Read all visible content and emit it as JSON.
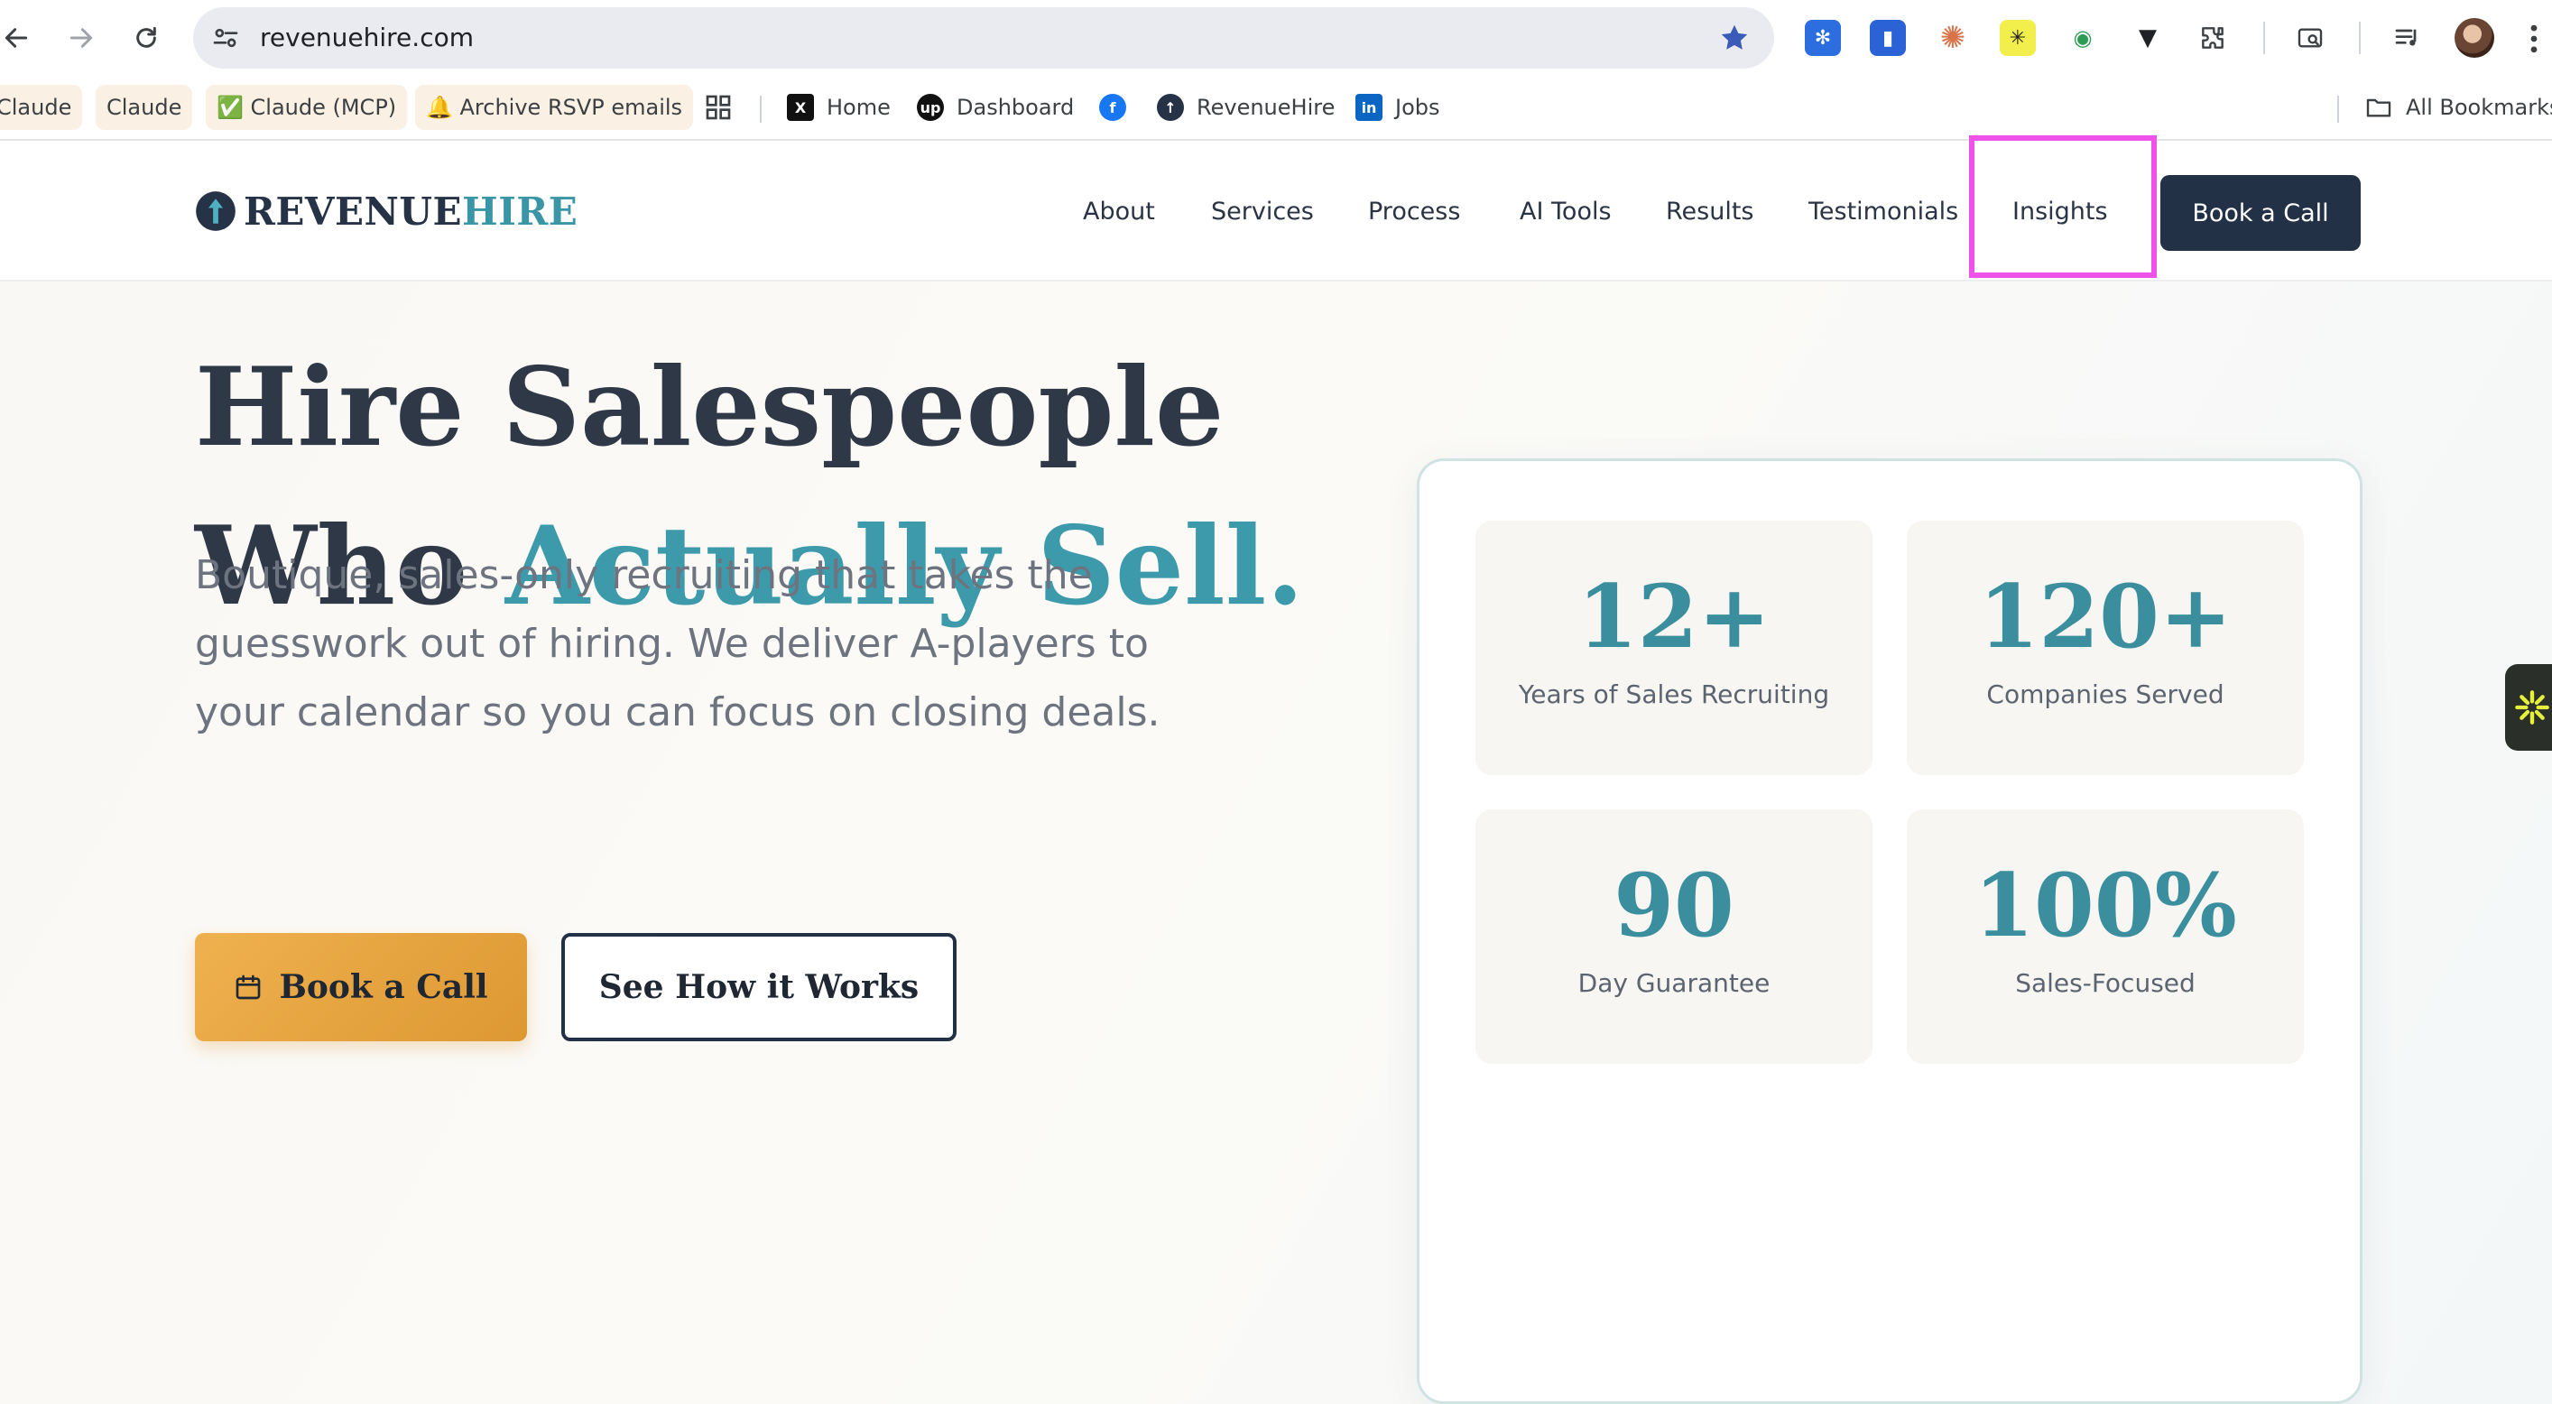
{
  "browser": {
    "url": "revenuehire.com",
    "bookmarks": [
      {
        "label": "Claude"
      },
      {
        "label": "Claude"
      },
      {
        "label": "✅ Claude (MCP)"
      },
      {
        "label": "🔔 Archive RSVP emails"
      },
      {
        "label": "Home"
      },
      {
        "label": "Dashboard"
      },
      {
        "label": "RevenueHire"
      },
      {
        "label": "Jobs"
      }
    ],
    "all_bookmarks": "All Bookmarks"
  },
  "site": {
    "logo_part1": "REVENUE",
    "logo_part2": "HIRE",
    "nav": [
      "About",
      "Services",
      "Process",
      "AI Tools",
      "Results",
      "Testimonials",
      "Insights"
    ],
    "header_cta": "Book a Call"
  },
  "hero": {
    "title_line1": "Hire Salespeople",
    "title_line2_plain": "Who ",
    "title_line2_accent": "Actually Sell.",
    "subtitle": "Boutique, sales-only recruiting that takes the guesswork out of hiring. We deliver A-players to your calendar so you can focus on closing deals.",
    "primary_cta": "Book a Call",
    "secondary_cta": "See How it Works"
  },
  "stats": [
    {
      "value": "12+",
      "label": "Years of Sales Recruiting"
    },
    {
      "value": "120+",
      "label": "Companies Served"
    },
    {
      "value": "90",
      "label": "Day Guarantee"
    },
    {
      "value": "100%",
      "label": "Sales-Focused"
    }
  ],
  "colors": {
    "accent_teal": "#3d9aaa",
    "navy": "#233146",
    "gold": "#e4a440",
    "highlight": "#ef52e8"
  }
}
